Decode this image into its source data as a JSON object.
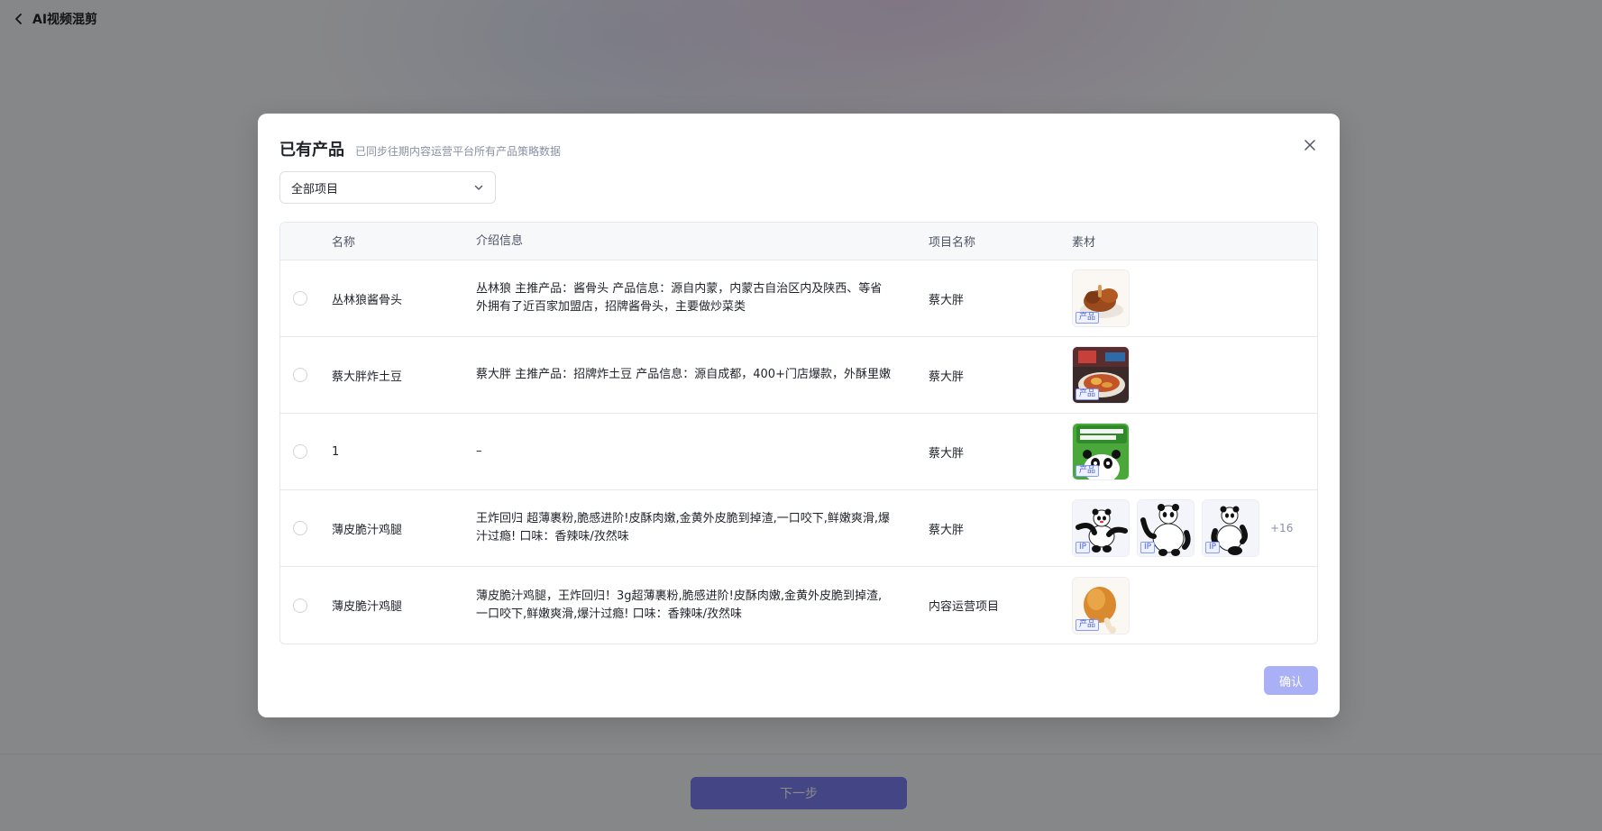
{
  "topbar": {
    "back_icon": "chevron-left-icon",
    "title": "AI视频混剪"
  },
  "footer": {
    "next_label": "下一步"
  },
  "modal": {
    "title": "已有产品",
    "subtitle": "已同步往期内容运营平台所有产品策略数据",
    "close_icon": "close-icon",
    "filter": {
      "selected": "全部项目",
      "icon": "chevron-down-icon"
    },
    "columns": {
      "name": "名称",
      "intro": "介绍信息",
      "project": "项目名称",
      "media": "素材"
    },
    "rows": [
      {
        "name": "丛林狼酱骨头",
        "intro": "丛林狼 主推产品：酱骨头 产品信息：源自内蒙，内蒙古自治区内及陕西、等省外拥有了近百家加盟店，招牌酱骨头，主要做炒菜类",
        "project": "蔡大胖",
        "media_tags": [
          "产品"
        ]
      },
      {
        "name": "蔡大胖炸土豆",
        "intro": "蔡大胖 主推产品：招牌炸土豆 产品信息：源自成都，400+门店爆款，外酥里嫩",
        "project": "蔡大胖",
        "media_tags": [
          "产品"
        ]
      },
      {
        "name": "1",
        "intro": "–",
        "project": "蔡大胖",
        "media_tags": [
          "产品"
        ]
      },
      {
        "name": "薄皮脆汁鸡腿",
        "intro": "王炸回归 超薄裹粉,脆感进阶!皮酥肉嫩,金黄外皮脆到掉渣,一口咬下,鲜嫩爽滑,爆汁过瘾! 口味：香辣味/孜然味",
        "project": "蔡大胖",
        "media_tags": [
          "IP",
          "IP",
          "IP"
        ],
        "more": "+16"
      },
      {
        "name": "薄皮脆汁鸡腿",
        "intro": "薄皮脆汁鸡腿，王炸回归！3g超薄裹粉,脆感进阶!皮酥肉嫩,金黄外皮脆到掉渣,一口咬下,鲜嫩爽滑,爆汁过瘾! 口味：香辣味/孜然味",
        "project": "内容运营项目",
        "media_tags": [
          "产品"
        ]
      }
    ],
    "confirm_label": "确认"
  }
}
